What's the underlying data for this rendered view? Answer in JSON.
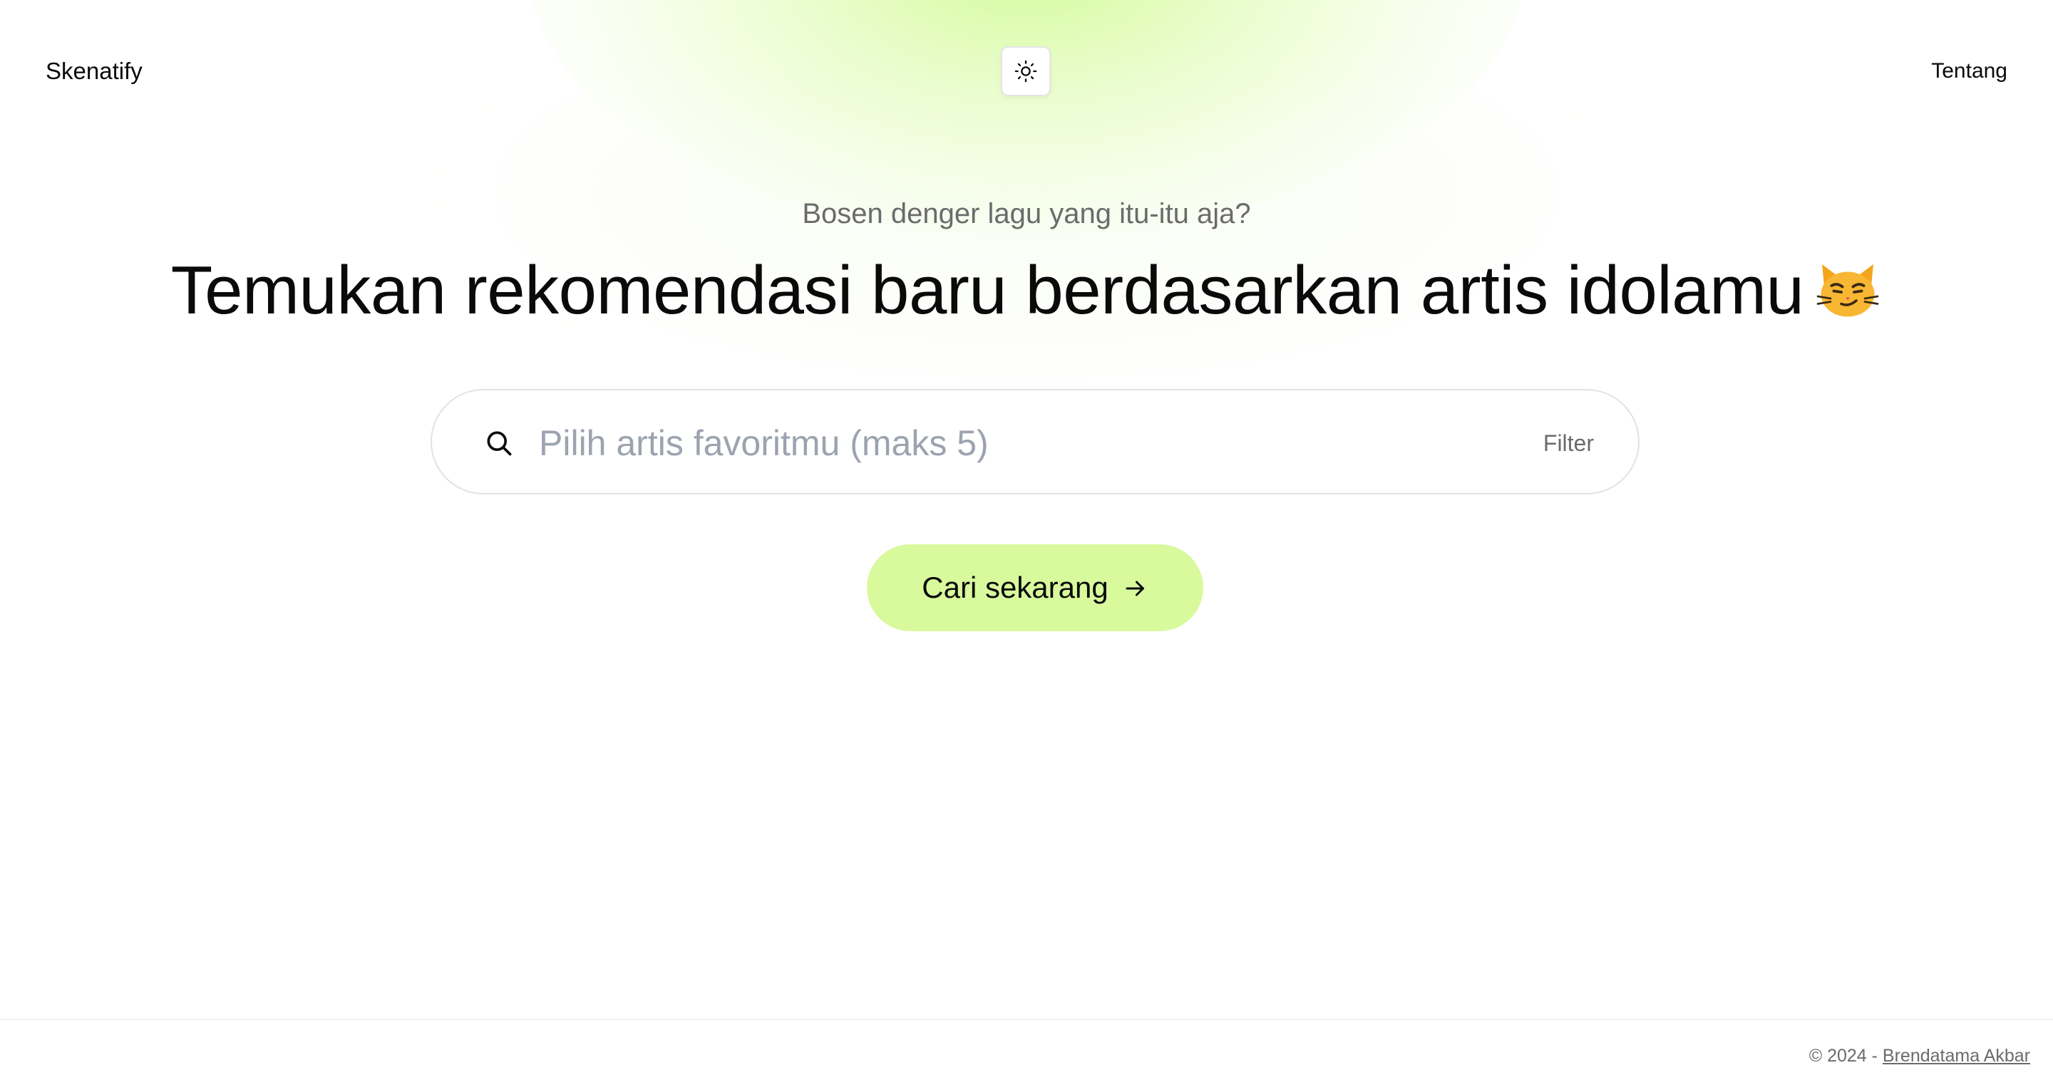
{
  "header": {
    "brand": "Skenatify",
    "theme_toggle_icon": "sun-icon",
    "nav_about": "Tentang"
  },
  "hero": {
    "subtitle": "Bosen denger lagu yang itu-itu aja?",
    "headline": "Temukan rekomendasi baru berdasarkan artis idolamu",
    "headline_emoji": "smirking-cat-emoji"
  },
  "search": {
    "icon": "search-icon",
    "value": "",
    "placeholder": "Pilih artis favoritmu (maks 5)",
    "filter_label": "Filter"
  },
  "cta": {
    "label": "Cari sekarang",
    "icon": "arrow-right-icon"
  },
  "footer": {
    "copyright": "© 2024 - ",
    "author": "Brendatama Akbar"
  },
  "colors": {
    "accent": "#d9f99d",
    "glow": "#d2fa96",
    "text": "#0a0a0a",
    "muted": "#6b6b6b",
    "placeholder": "#9ca3af",
    "border": "#e2e2e2"
  }
}
